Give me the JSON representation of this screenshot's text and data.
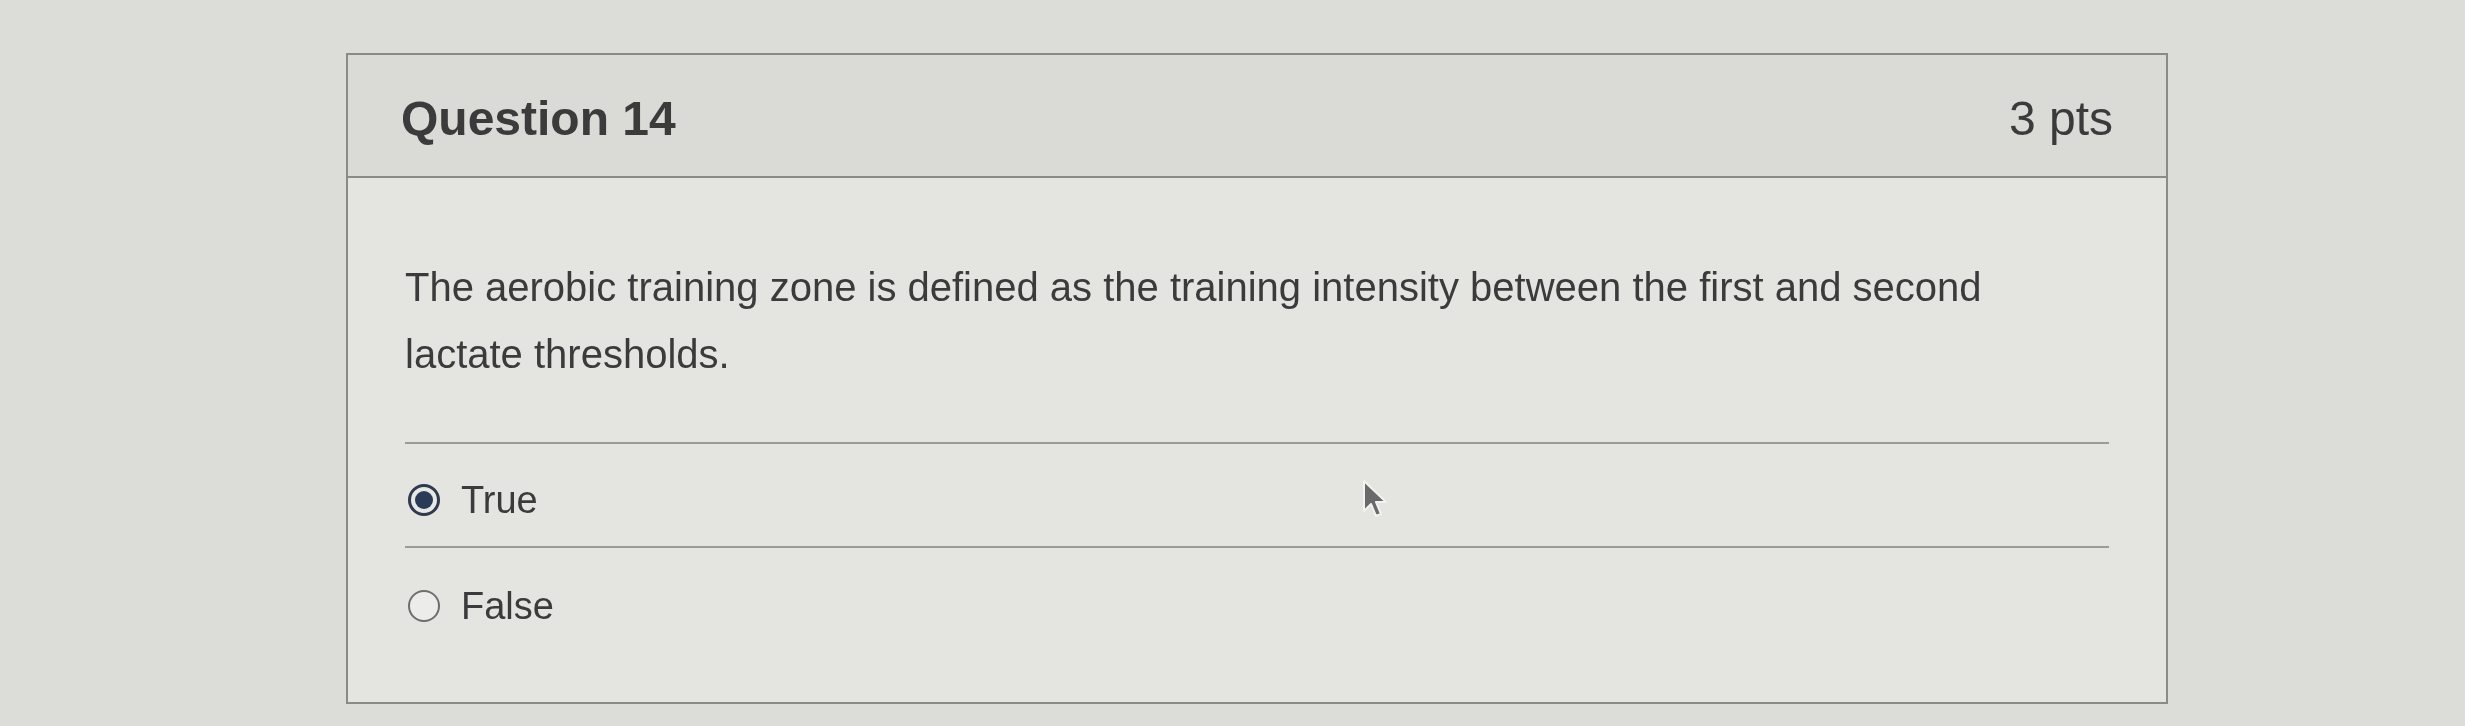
{
  "question": {
    "title": "Question 14",
    "points": "3 pts",
    "text": "The aerobic training zone is defined as the training intensity between the first and second lactate thresholds.",
    "answers": [
      {
        "label": "True",
        "selected": true
      },
      {
        "label": "False",
        "selected": false
      }
    ]
  }
}
